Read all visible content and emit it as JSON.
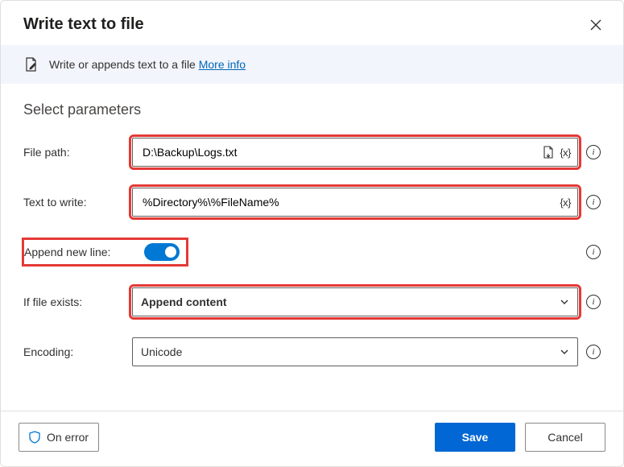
{
  "header": {
    "title": "Write text to file"
  },
  "banner": {
    "text": "Write or appends text to a file ",
    "link": "More info"
  },
  "section_title": "Select parameters",
  "fields": {
    "file_path": {
      "label": "File path:",
      "value": "D:\\Backup\\Logs.txt"
    },
    "text_to_write": {
      "label": "Text to write:",
      "value": "%Directory%\\%FileName%"
    },
    "append_new_line": {
      "label": "Append new line:",
      "value": true
    },
    "if_file_exists": {
      "label": "If file exists:",
      "value": "Append content"
    },
    "encoding": {
      "label": "Encoding:",
      "value": "Unicode"
    }
  },
  "footer": {
    "on_error": "On error",
    "save": "Save",
    "cancel": "Cancel"
  },
  "tokens": {
    "var": "{x}"
  }
}
